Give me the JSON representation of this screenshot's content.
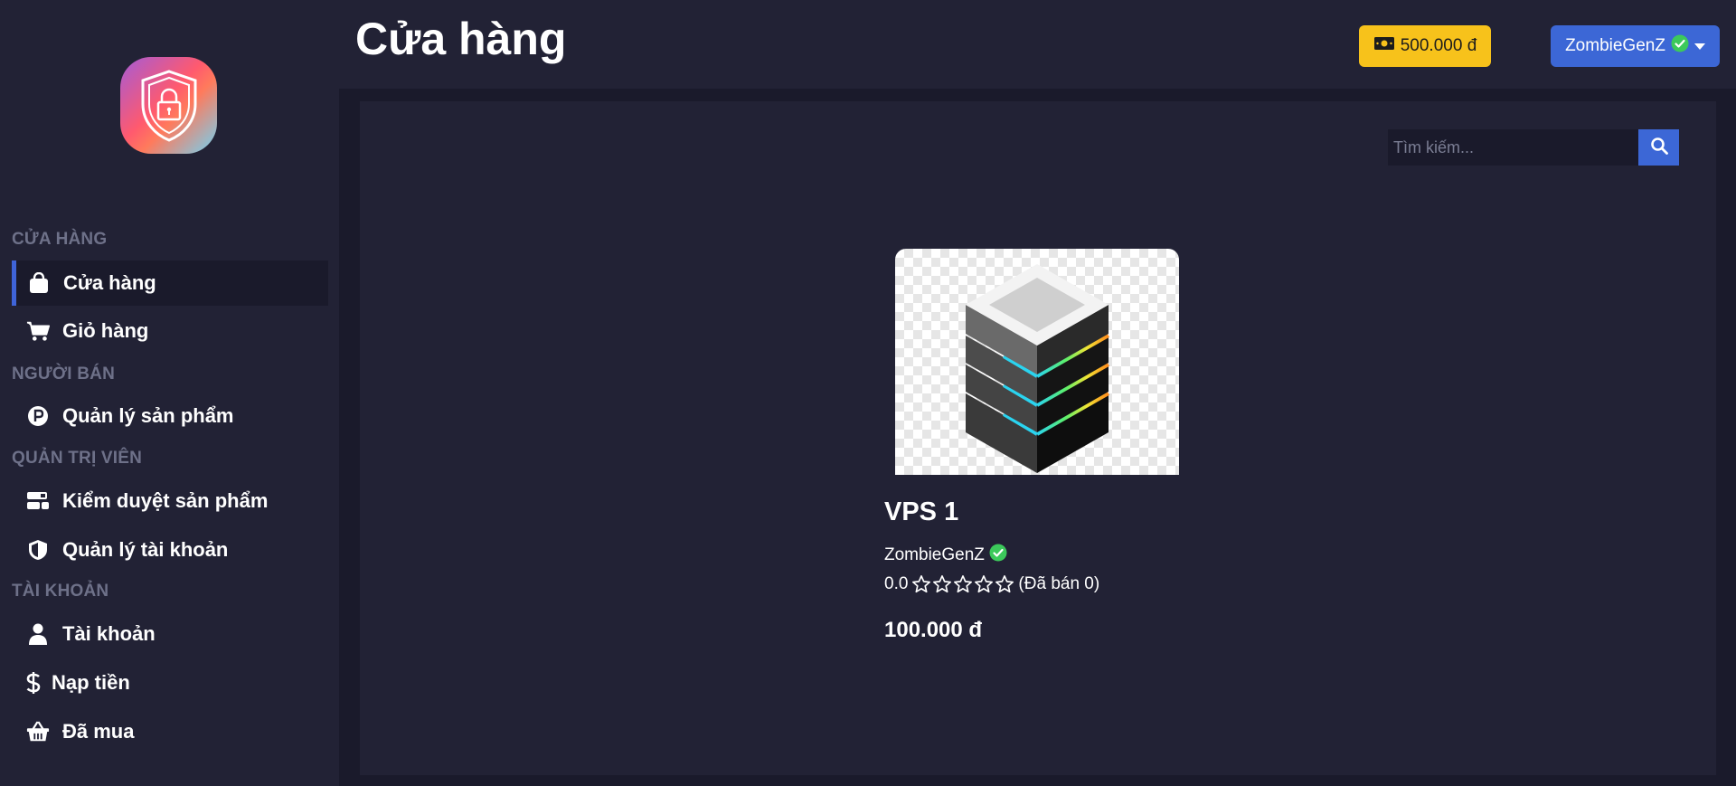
{
  "header": {
    "title": "Cửa hàng",
    "balance": "500.000 đ",
    "username": "ZombieGenZ"
  },
  "sidebar": {
    "sections": [
      {
        "label": "CỬA HÀNG"
      },
      {
        "label": "NGƯỜI BÁN"
      },
      {
        "label": "QUẢN TRỊ VIÊN"
      },
      {
        "label": "TÀI KHOẢN"
      }
    ],
    "items": [
      {
        "label": "Cửa hàng",
        "icon": "shopping-bag-icon",
        "active": true
      },
      {
        "label": "Giỏ hàng",
        "icon": "cart-icon"
      },
      {
        "label": "Quản lý sản phẩm",
        "icon": "product-p-icon"
      },
      {
        "label": "Kiểm duyệt sản phẩm",
        "icon": "moderation-icon"
      },
      {
        "label": "Quản lý tài khoản",
        "icon": "shield-icon"
      },
      {
        "label": "Tài khoản",
        "icon": "user-icon"
      },
      {
        "label": "Nạp tiền",
        "icon": "dollar-icon"
      },
      {
        "label": "Đã mua",
        "icon": "basket-icon"
      }
    ]
  },
  "search": {
    "placeholder": "Tìm kiếm..."
  },
  "product": {
    "name": "VPS 1",
    "seller": "ZombieGenZ",
    "rating": "0.0",
    "sold": "(Đã bán 0)",
    "price": "100.000 đ",
    "image_icon": "server-stack-icon"
  },
  "colors": {
    "background": "#222235",
    "panel_dark": "#1a1a2b",
    "accent_blue": "#3c67d6",
    "balance_yellow": "#f7c21b",
    "verified_green": "#3cc95b",
    "section_label": "#6e7189"
  }
}
